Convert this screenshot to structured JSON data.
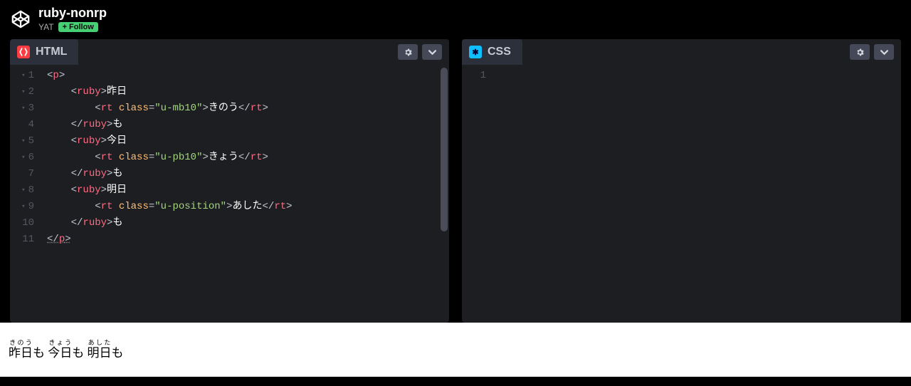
{
  "header": {
    "pen_title": "ruby-nonrp",
    "author": "YAT",
    "follow_label": "Follow"
  },
  "panels": {
    "html": {
      "title": "HTML",
      "lines": [
        {
          "n": 1,
          "fold": true,
          "segs": [
            {
              "t": "<",
              "c": "punct"
            },
            {
              "t": "p",
              "c": "tag"
            },
            {
              "t": ">",
              "c": "punct"
            }
          ]
        },
        {
          "n": 2,
          "fold": true,
          "indent": 2,
          "segs": [
            {
              "t": "<",
              "c": "punct"
            },
            {
              "t": "ruby",
              "c": "tag"
            },
            {
              "t": ">",
              "c": "punct"
            },
            {
              "t": "昨日",
              "c": "text"
            }
          ]
        },
        {
          "n": 3,
          "fold": true,
          "indent": 4,
          "segs": [
            {
              "t": "<",
              "c": "punct"
            },
            {
              "t": "rt",
              "c": "tag"
            },
            {
              "t": " ",
              "c": "punct"
            },
            {
              "t": "class",
              "c": "attr"
            },
            {
              "t": "=",
              "c": "punct"
            },
            {
              "t": "\"u-mb10\"",
              "c": "string"
            },
            {
              "t": ">",
              "c": "punct"
            },
            {
              "t": "きのう",
              "c": "text"
            },
            {
              "t": "</",
              "c": "punct"
            },
            {
              "t": "rt",
              "c": "tag"
            },
            {
              "t": ">",
              "c": "punct"
            }
          ]
        },
        {
          "n": 4,
          "fold": false,
          "indent": 2,
          "segs": [
            {
              "t": "</",
              "c": "punct"
            },
            {
              "t": "ruby",
              "c": "tag"
            },
            {
              "t": ">",
              "c": "punct"
            },
            {
              "t": "も",
              "c": "text"
            }
          ]
        },
        {
          "n": 5,
          "fold": true,
          "indent": 2,
          "segs": [
            {
              "t": "<",
              "c": "punct"
            },
            {
              "t": "ruby",
              "c": "tag"
            },
            {
              "t": ">",
              "c": "punct"
            },
            {
              "t": "今日",
              "c": "text"
            }
          ]
        },
        {
          "n": 6,
          "fold": true,
          "indent": 4,
          "segs": [
            {
              "t": "<",
              "c": "punct"
            },
            {
              "t": "rt",
              "c": "tag"
            },
            {
              "t": " ",
              "c": "punct"
            },
            {
              "t": "class",
              "c": "attr"
            },
            {
              "t": "=",
              "c": "punct"
            },
            {
              "t": "\"u-pb10\"",
              "c": "string"
            },
            {
              "t": ">",
              "c": "punct"
            },
            {
              "t": "きょう",
              "c": "text"
            },
            {
              "t": "</",
              "c": "punct"
            },
            {
              "t": "rt",
              "c": "tag"
            },
            {
              "t": ">",
              "c": "punct"
            }
          ]
        },
        {
          "n": 7,
          "fold": false,
          "indent": 2,
          "segs": [
            {
              "t": "</",
              "c": "punct"
            },
            {
              "t": "ruby",
              "c": "tag"
            },
            {
              "t": ">",
              "c": "punct"
            },
            {
              "t": "も",
              "c": "text"
            }
          ]
        },
        {
          "n": 8,
          "fold": true,
          "indent": 2,
          "segs": [
            {
              "t": "<",
              "c": "punct"
            },
            {
              "t": "ruby",
              "c": "tag"
            },
            {
              "t": ">",
              "c": "punct"
            },
            {
              "t": "明日",
              "c": "text"
            }
          ]
        },
        {
          "n": 9,
          "fold": true,
          "indent": 4,
          "segs": [
            {
              "t": "<",
              "c": "punct"
            },
            {
              "t": "rt",
              "c": "tag"
            },
            {
              "t": " ",
              "c": "punct"
            },
            {
              "t": "class",
              "c": "attr"
            },
            {
              "t": "=",
              "c": "punct"
            },
            {
              "t": "\"u-position\"",
              "c": "string"
            },
            {
              "t": ">",
              "c": "punct"
            },
            {
              "t": "あした",
              "c": "text"
            },
            {
              "t": "</",
              "c": "punct"
            },
            {
              "t": "rt",
              "c": "tag"
            },
            {
              "t": ">",
              "c": "punct"
            }
          ]
        },
        {
          "n": 10,
          "fold": false,
          "indent": 2,
          "segs": [
            {
              "t": "</",
              "c": "punct"
            },
            {
              "t": "ruby",
              "c": "tag"
            },
            {
              "t": ">",
              "c": "punct"
            },
            {
              "t": "も",
              "c": "text"
            }
          ]
        },
        {
          "n": 11,
          "fold": false,
          "segs": [
            {
              "t": "</",
              "c": "punct underline"
            },
            {
              "t": "p",
              "c": "tag underline"
            },
            {
              "t": ">",
              "c": "punct underline"
            }
          ]
        }
      ]
    },
    "css": {
      "title": "CSS",
      "lines": [
        {
          "n": 1,
          "segs": []
        }
      ]
    }
  },
  "result": {
    "words": [
      {
        "base": "昨日",
        "rt": "きのう",
        "tail": "も"
      },
      {
        "base": "今日",
        "rt": "きょう",
        "tail": "も"
      },
      {
        "base": "明日",
        "rt": "あした",
        "tail": "も"
      }
    ]
  }
}
